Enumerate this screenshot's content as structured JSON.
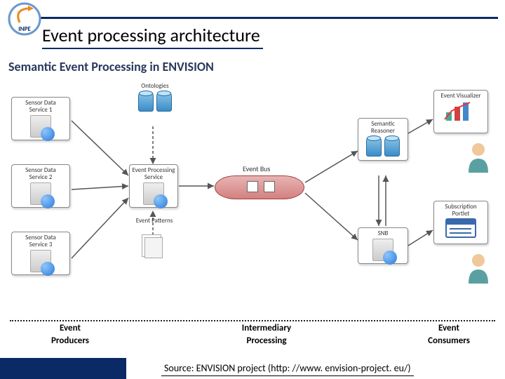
{
  "header": {
    "logo_text": "INPE",
    "title": "Event processing architecture",
    "subtitle": "Semantic Event Processing in ENVISION"
  },
  "nodes": {
    "sensor1": "Sensor Data\nService 1",
    "sensor2": "Sensor Data\nService 2",
    "sensor3": "Sensor Data\nService 3",
    "ontologies": "Ontologies",
    "eps": "Event Processing\nService",
    "patterns": "Event Patterns",
    "bus": "Event Bus",
    "semreason": "Semantic\nReasoner",
    "snb": "SNB",
    "visual": "Event Visualizer",
    "portlet": "Subscription\nPortlet"
  },
  "legend": {
    "col1_top": "Event",
    "col1_bot": "Producers",
    "col2_top": "Intermediary",
    "col2_bot": "Processing",
    "col3_top": "Event",
    "col3_bot": "Consumers"
  },
  "footer": {
    "source": "Source: ENVISION project (http: //www. envision-project. eu/)"
  },
  "colors": {
    "brand": "#0a2a66",
    "bus_fill": "#d48080",
    "db_fill": "#3a8cc8"
  }
}
